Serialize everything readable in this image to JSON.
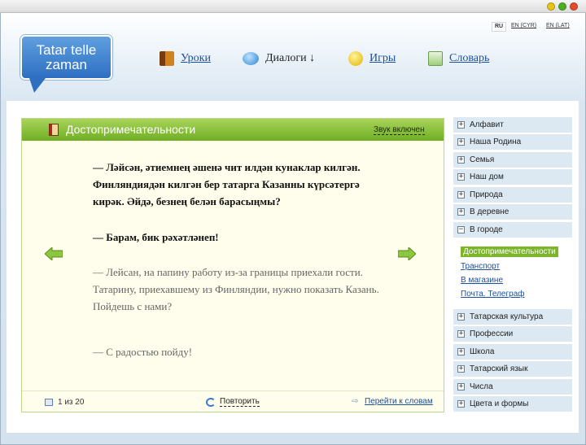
{
  "logo": {
    "line1": "Tatar telle",
    "line2": "zaman"
  },
  "languages": {
    "ru": "RU",
    "en_cyr": "EN (CYR)",
    "en_lat": "EN (LAT)"
  },
  "nav": {
    "lessons": "Уроки",
    "dialogs": "Диалоги ↓",
    "games": "Игры",
    "dictionary": "Словарь"
  },
  "card": {
    "title": "Достопримечательности",
    "sound": "Звук включен",
    "tatar_1": "— Ләйсән, әтиемнең әшенә чит илдән кунаклар килгән. Финляндиядән килгән бер татарга Казанны күрсәтергә кирәк. Әйдә, безнең белән барасыңмы?",
    "tatar_2": "— Барам, бик рәхәтләнеп!",
    "russian_1": "— Лейсан, на папину работу из-за границы приехали гости. Татарину, приехавшему из Финляндии, нужно показать Казань. Пойдешь с нами?",
    "russian_2": "— С радостью пойду!",
    "counter": "1 из 20",
    "repeat": "Повторить",
    "goto_words": "Перейти к словам"
  },
  "sidebar": {
    "top_items": [
      "Алфавит",
      "Наша Родина",
      "Семья",
      "Наш дом",
      "Природа",
      "В деревне",
      "В городе"
    ],
    "sub_items": [
      "Достопримечательности",
      "Транспорт",
      "В магазине",
      "Почта. Телеграф"
    ],
    "bottom_items": [
      "Татарская культура",
      "Профессии",
      "Школа",
      "Татарский язык",
      "Числа",
      "Цвета и формы"
    ],
    "expanded_symbol": "−",
    "collapsed_symbol": "+"
  },
  "colors": {
    "accent_green": "#7ab52a",
    "link_blue": "#1b4f9c",
    "sidebar_bg": "#dce9f3"
  }
}
